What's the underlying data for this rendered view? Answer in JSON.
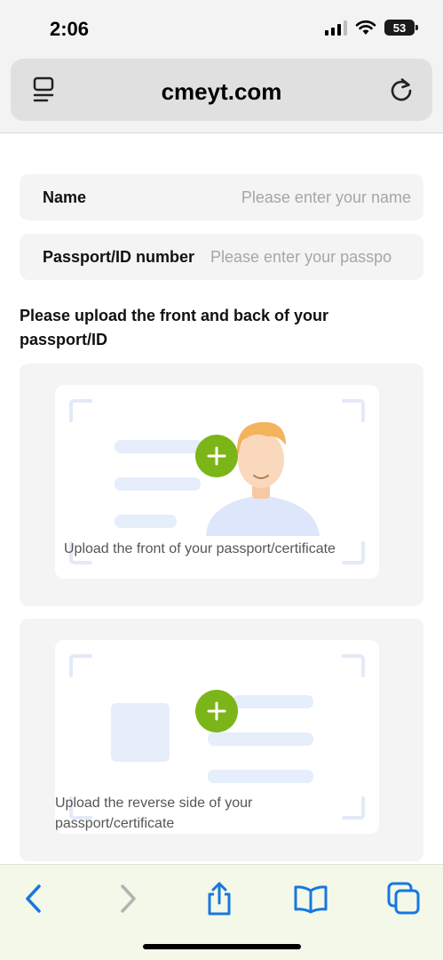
{
  "status_bar": {
    "time": "2:06",
    "battery": "53",
    "icons": [
      "cellular-signal-icon",
      "wifi-icon",
      "battery-icon"
    ]
  },
  "browser": {
    "url": "cmeyt.com",
    "reader_icon": "reader-list-icon",
    "reload_icon": "reload-icon"
  },
  "form": {
    "name_label": "Name",
    "name_placeholder": "Please enter your name",
    "name_value": "",
    "id_label": "Passport/ID number",
    "id_placeholder": "Please enter your passpo",
    "id_value": "",
    "upload_title": "Please upload the front and back of your passport/ID",
    "front_label": "Upload the front of your passport/certificate",
    "back_label": "Upload the reverse side of your passport/certificate",
    "add_icon": "plus-icon"
  },
  "toolbar": {
    "items": [
      "back-icon",
      "forward-icon",
      "share-icon",
      "bookmarks-icon",
      "tabs-icon"
    ]
  },
  "colors": {
    "accent_green": "#7cb518",
    "ios_blue": "#1877e0",
    "illustration_blue": "#e6edfb"
  }
}
